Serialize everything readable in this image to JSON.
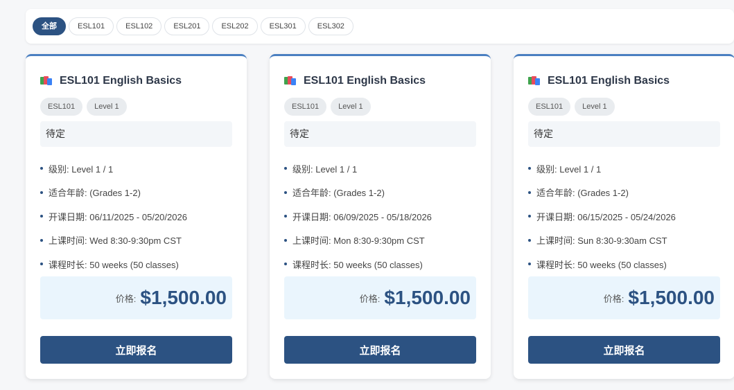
{
  "filters": {
    "items": [
      "全部",
      "ESL101",
      "ESL102",
      "ESL201",
      "ESL202",
      "ESL301",
      "ESL302"
    ],
    "active_index": 0
  },
  "colors": {
    "primary": "#2c5282",
    "price_bg": "#eaf5fd",
    "card_top_border": "#4a7fc1"
  },
  "courses": [
    {
      "title": "ESL101 English Basics",
      "icon": "books-icon",
      "tags": [
        "ESL101",
        "Level 1"
      ],
      "status": "待定",
      "details": [
        "级别: Level 1 / 1",
        "适合年龄: (Grades 1-2)",
        "开课日期: 06/11/2025 - 05/20/2026",
        "上课时间: Wed 8:30-9:30pm CST",
        "课程时长: 50 weeks (50 classes)"
      ],
      "price_label": "价格:",
      "price": "$1,500.00",
      "button_label": "立即报名"
    },
    {
      "title": "ESL101 English Basics",
      "icon": "books-icon",
      "tags": [
        "ESL101",
        "Level 1"
      ],
      "status": "待定",
      "details": [
        "级别: Level 1 / 1",
        "适合年龄: (Grades 1-2)",
        "开课日期: 06/09/2025 - 05/18/2026",
        "上课时间: Mon 8:30-9:30pm CST",
        "课程时长: 50 weeks (50 classes)"
      ],
      "price_label": "价格:",
      "price": "$1,500.00",
      "button_label": "立即报名"
    },
    {
      "title": "ESL101 English Basics",
      "icon": "books-icon",
      "tags": [
        "ESL101",
        "Level 1"
      ],
      "status": "待定",
      "details": [
        "级别: Level 1 / 1",
        "适合年龄: (Grades 1-2)",
        "开课日期: 06/15/2025 - 05/24/2026",
        "上课时间: Sun 8:30-9:30am CST",
        "课程时长: 50 weeks (50 classes)"
      ],
      "price_label": "价格:",
      "price": "$1,500.00",
      "button_label": "立即报名"
    }
  ]
}
